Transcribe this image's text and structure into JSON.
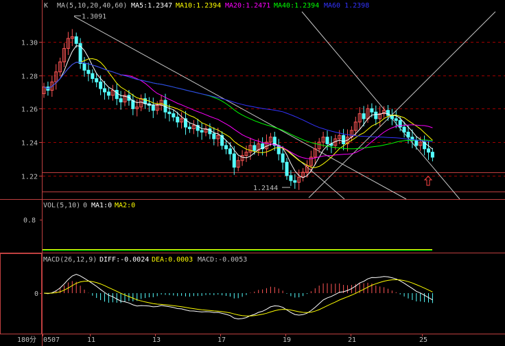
{
  "price_panel": {
    "header": {
      "k_label": "K",
      "ma_params": "MA(5,10,20,40,60)",
      "ma5": "MA5:1.2347",
      "ma10": "MA10:1.2394",
      "ma20": "MA20:1.2471",
      "ma40": "MA40:1.2394",
      "ma60": "MA60 1.2398"
    },
    "high_label": "1.3091",
    "low_label": "1.2144",
    "y_ticks": [
      "1.30",
      "1.28",
      "1.26",
      "1.24",
      "1.22"
    ]
  },
  "volume_panel": {
    "header": {
      "params": "VOL(5,10)",
      "value": "0",
      "ma1": "MA1:0",
      "ma2": "MA2:0"
    },
    "y_tick": "0.8"
  },
  "macd_panel": {
    "header": {
      "params": "MACD(26,12,9)",
      "diff": "DIFF:-0.0024",
      "dea": "DEA:0.0003",
      "macd": "MACD:-0.0053"
    },
    "y_tick": "0"
  },
  "x_axis": {
    "period_label": "180分",
    "labels": [
      "0507",
      "11",
      "13",
      "17",
      "19",
      "21",
      "25"
    ]
  },
  "colors": {
    "up": "#ff5555",
    "down": "#55ffff",
    "ma5": "#ffffff",
    "ma10": "#ffff00",
    "ma20": "#ff00ff",
    "ma40": "#00ff00",
    "ma60": "#3333ff",
    "grid": "#a00000",
    "frame": "#c04040",
    "axis_text": "#c0c0c0"
  },
  "chart_data": {
    "type": "candlestick",
    "y_range": [
      1.208,
      1.318
    ],
    "closes": [
      1.273,
      1.271,
      1.276,
      1.282,
      1.288,
      1.296,
      1.302,
      1.303,
      1.299,
      1.287,
      1.283,
      1.281,
      1.278,
      1.276,
      1.272,
      1.27,
      1.268,
      1.271,
      1.266,
      1.264,
      1.268,
      1.265,
      1.26,
      1.261,
      1.266,
      1.263,
      1.262,
      1.259,
      1.262,
      1.265,
      1.258,
      1.257,
      1.255,
      1.252,
      1.254,
      1.249,
      1.248,
      1.25,
      1.247,
      1.246,
      1.248,
      1.245,
      1.242,
      1.244,
      1.238,
      1.236,
      1.233,
      1.225,
      1.229,
      1.232,
      1.234,
      1.238,
      1.235,
      1.239,
      1.236,
      1.24,
      1.243,
      1.238,
      1.233,
      1.228,
      1.22,
      1.217,
      1.216,
      1.219,
      1.222,
      1.226,
      1.231,
      1.236,
      1.24,
      1.243,
      1.239,
      1.238,
      1.242,
      1.244,
      1.239,
      1.243,
      1.247,
      1.252,
      1.257,
      1.254,
      1.26,
      1.258,
      1.254,
      1.257,
      1.259,
      1.256,
      1.254,
      1.253,
      1.249,
      1.246,
      1.243,
      1.241,
      1.238,
      1.24,
      1.236,
      1.234,
      1.231
    ],
    "ma_last": {
      "ma5": 1.2347,
      "ma10": 1.2394,
      "ma20": 1.2471,
      "ma40": 1.2394,
      "ma60": 1.2398
    },
    "macd_last": {
      "diff": -0.0024,
      "dea": 0.0003,
      "macd": -0.0053
    }
  }
}
